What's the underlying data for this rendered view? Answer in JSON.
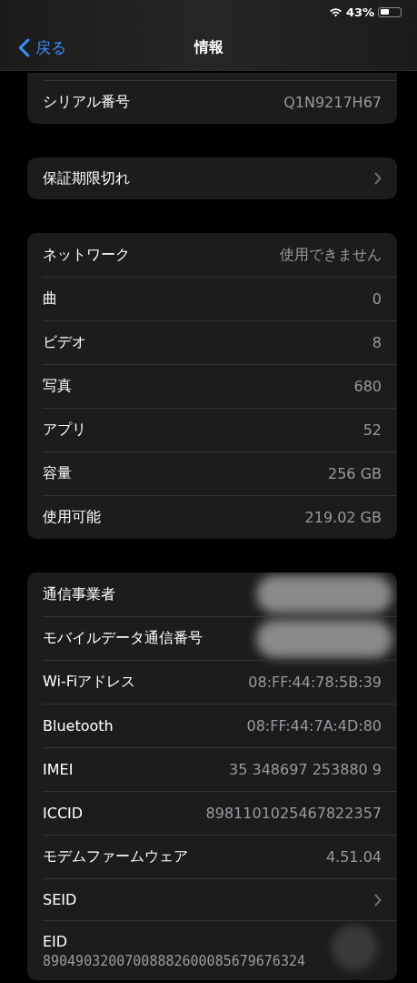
{
  "status_bar": {
    "battery_text": "43%"
  },
  "nav": {
    "back": "戻る",
    "title": "情報"
  },
  "sections": [
    {
      "cut_top": true,
      "rows": [
        {
          "kind": "value",
          "label": "シリアル番号",
          "value": "Q1N9217H67"
        }
      ]
    },
    {
      "cut_top": false,
      "rows": [
        {
          "kind": "disclosure",
          "label": "保証期限切れ"
        }
      ]
    },
    {
      "cut_top": false,
      "rows": [
        {
          "kind": "value",
          "label": "ネットワーク",
          "value": "使用できません"
        },
        {
          "kind": "value",
          "label": "曲",
          "value": "0"
        },
        {
          "kind": "value",
          "label": "ビデオ",
          "value": "8"
        },
        {
          "kind": "value",
          "label": "写真",
          "value": "680"
        },
        {
          "kind": "value",
          "label": "アプリ",
          "value": "52"
        },
        {
          "kind": "value",
          "label": "容量",
          "value": "256 GB"
        },
        {
          "kind": "value",
          "label": "使用可能",
          "value": "219.02 GB"
        }
      ]
    },
    {
      "cut_top": false,
      "rows": [
        {
          "kind": "redacted",
          "label": "通信事業者"
        },
        {
          "kind": "redacted",
          "label": "モバイルデータ通信番号"
        },
        {
          "kind": "value",
          "label": "Wi-Fiアドレス",
          "value": "08:FF:44:78:5B:39"
        },
        {
          "kind": "value",
          "label": "Bluetooth",
          "value": "08:FF:44:7A:4D:80"
        },
        {
          "kind": "value",
          "label": "IMEI",
          "value": "35 348697 253880 9"
        },
        {
          "kind": "value",
          "label": "ICCID",
          "value": "8981101025467822357"
        },
        {
          "kind": "value",
          "label": "モデムファームウェア",
          "value": "4.51.04"
        },
        {
          "kind": "disclosure",
          "label": "SEID"
        },
        {
          "kind": "stacked",
          "label": "EID",
          "value": "89049032007008882600085679676324",
          "smudged": true
        }
      ]
    }
  ]
}
